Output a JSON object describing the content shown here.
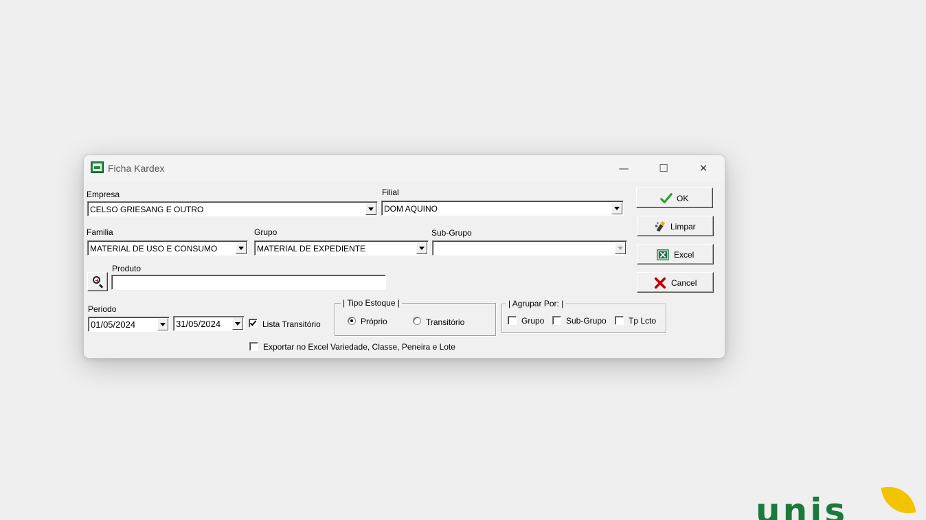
{
  "window": {
    "title": "Ficha Kardex",
    "minimize_glyph": "—",
    "maximize_glyph": "☐",
    "close_glyph": "✕"
  },
  "form": {
    "empresa": {
      "label": "Empresa",
      "value": "CELSO GRIESANG E OUTRO"
    },
    "filial": {
      "label": "Filial",
      "value": "DOM AQUINO"
    },
    "familia": {
      "label": "Familia",
      "value": "MATERIAL DE USO E CONSUMO"
    },
    "grupo": {
      "label": "Grupo",
      "value": "MATERIAL DE EXPEDIENTE"
    },
    "subgrupo": {
      "label": "Sub-Grupo",
      "value": ""
    },
    "produto": {
      "label": "Produto",
      "value": ""
    },
    "periodo": {
      "label": "Periodo",
      "start": "01/05/2024",
      "end": "31/05/2024"
    },
    "lista_transitorio": {
      "label": "Lista Transitório",
      "checked": true
    },
    "exportar_excel": {
      "label": "Exportar no Excel Variedade, Classe, Peneira e Lote",
      "checked": false
    },
    "tipo_estoque": {
      "title": "| Tipo Estoque |",
      "options": [
        {
          "label": "Próprio",
          "selected": true
        },
        {
          "label": "Transitório",
          "selected": false
        }
      ]
    },
    "agrupar_por": {
      "title": "| Agrupar Por: |",
      "options": [
        {
          "label": "Grupo",
          "checked": false
        },
        {
          "label": "Sub-Grupo",
          "checked": false
        },
        {
          "label": "Tp Lcto",
          "checked": false
        }
      ]
    }
  },
  "buttons": {
    "ok": "OK",
    "limpar": "Limpar",
    "excel": "Excel",
    "cancel": "Cancel"
  },
  "icons": {
    "app": "kardex-app-icon",
    "search": "zoom-in-icon",
    "ok": "checkmark-icon",
    "limpar": "eraser-icon",
    "excel": "excel-icon",
    "cancel": "x-icon"
  },
  "colors": {
    "ok_check": "#2e9e2e",
    "cancel_x": "#c00000",
    "excel_green": "#1d7044",
    "logo_green": "#1b7a3b",
    "logo_yellow": "#f2c400"
  },
  "logo": {
    "text": "unis"
  }
}
